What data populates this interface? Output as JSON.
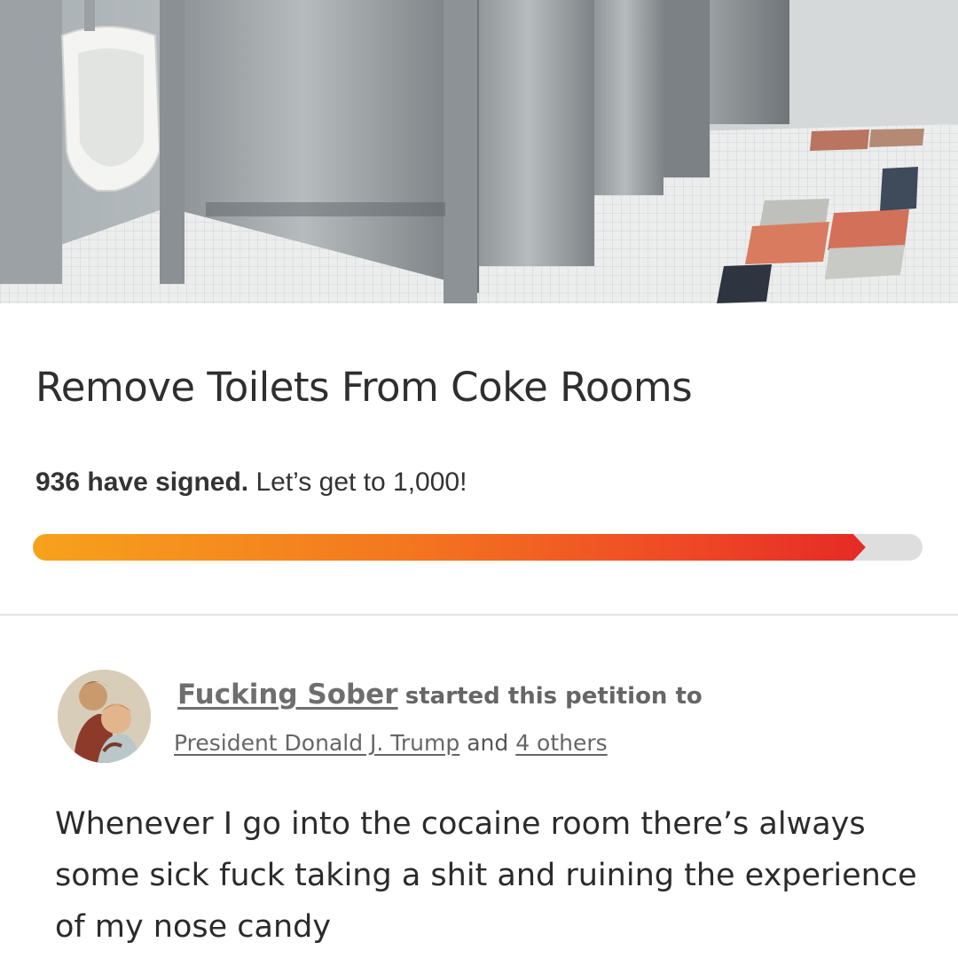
{
  "petition": {
    "title": "Remove Toilets From Coke Rooms",
    "signed_count_text": "936 have signed.",
    "goal_text": "Let’s get to 1,000!",
    "signatures": 936,
    "goal": 1000
  },
  "starter": {
    "author_name": "Fucking Sober",
    "started_text": "started this petition to",
    "target_name": "President Donald J. Trump",
    "and_text": "and",
    "others_text": "4 others"
  },
  "body": {
    "text": "Whenever I go into the cocaine room there’s always some sick fuck taking a shit and ruining the experience of my nose candy"
  },
  "colors": {
    "progress_start": "#f7a21c",
    "progress_end": "#e52a26",
    "progress_track": "#dedede"
  }
}
